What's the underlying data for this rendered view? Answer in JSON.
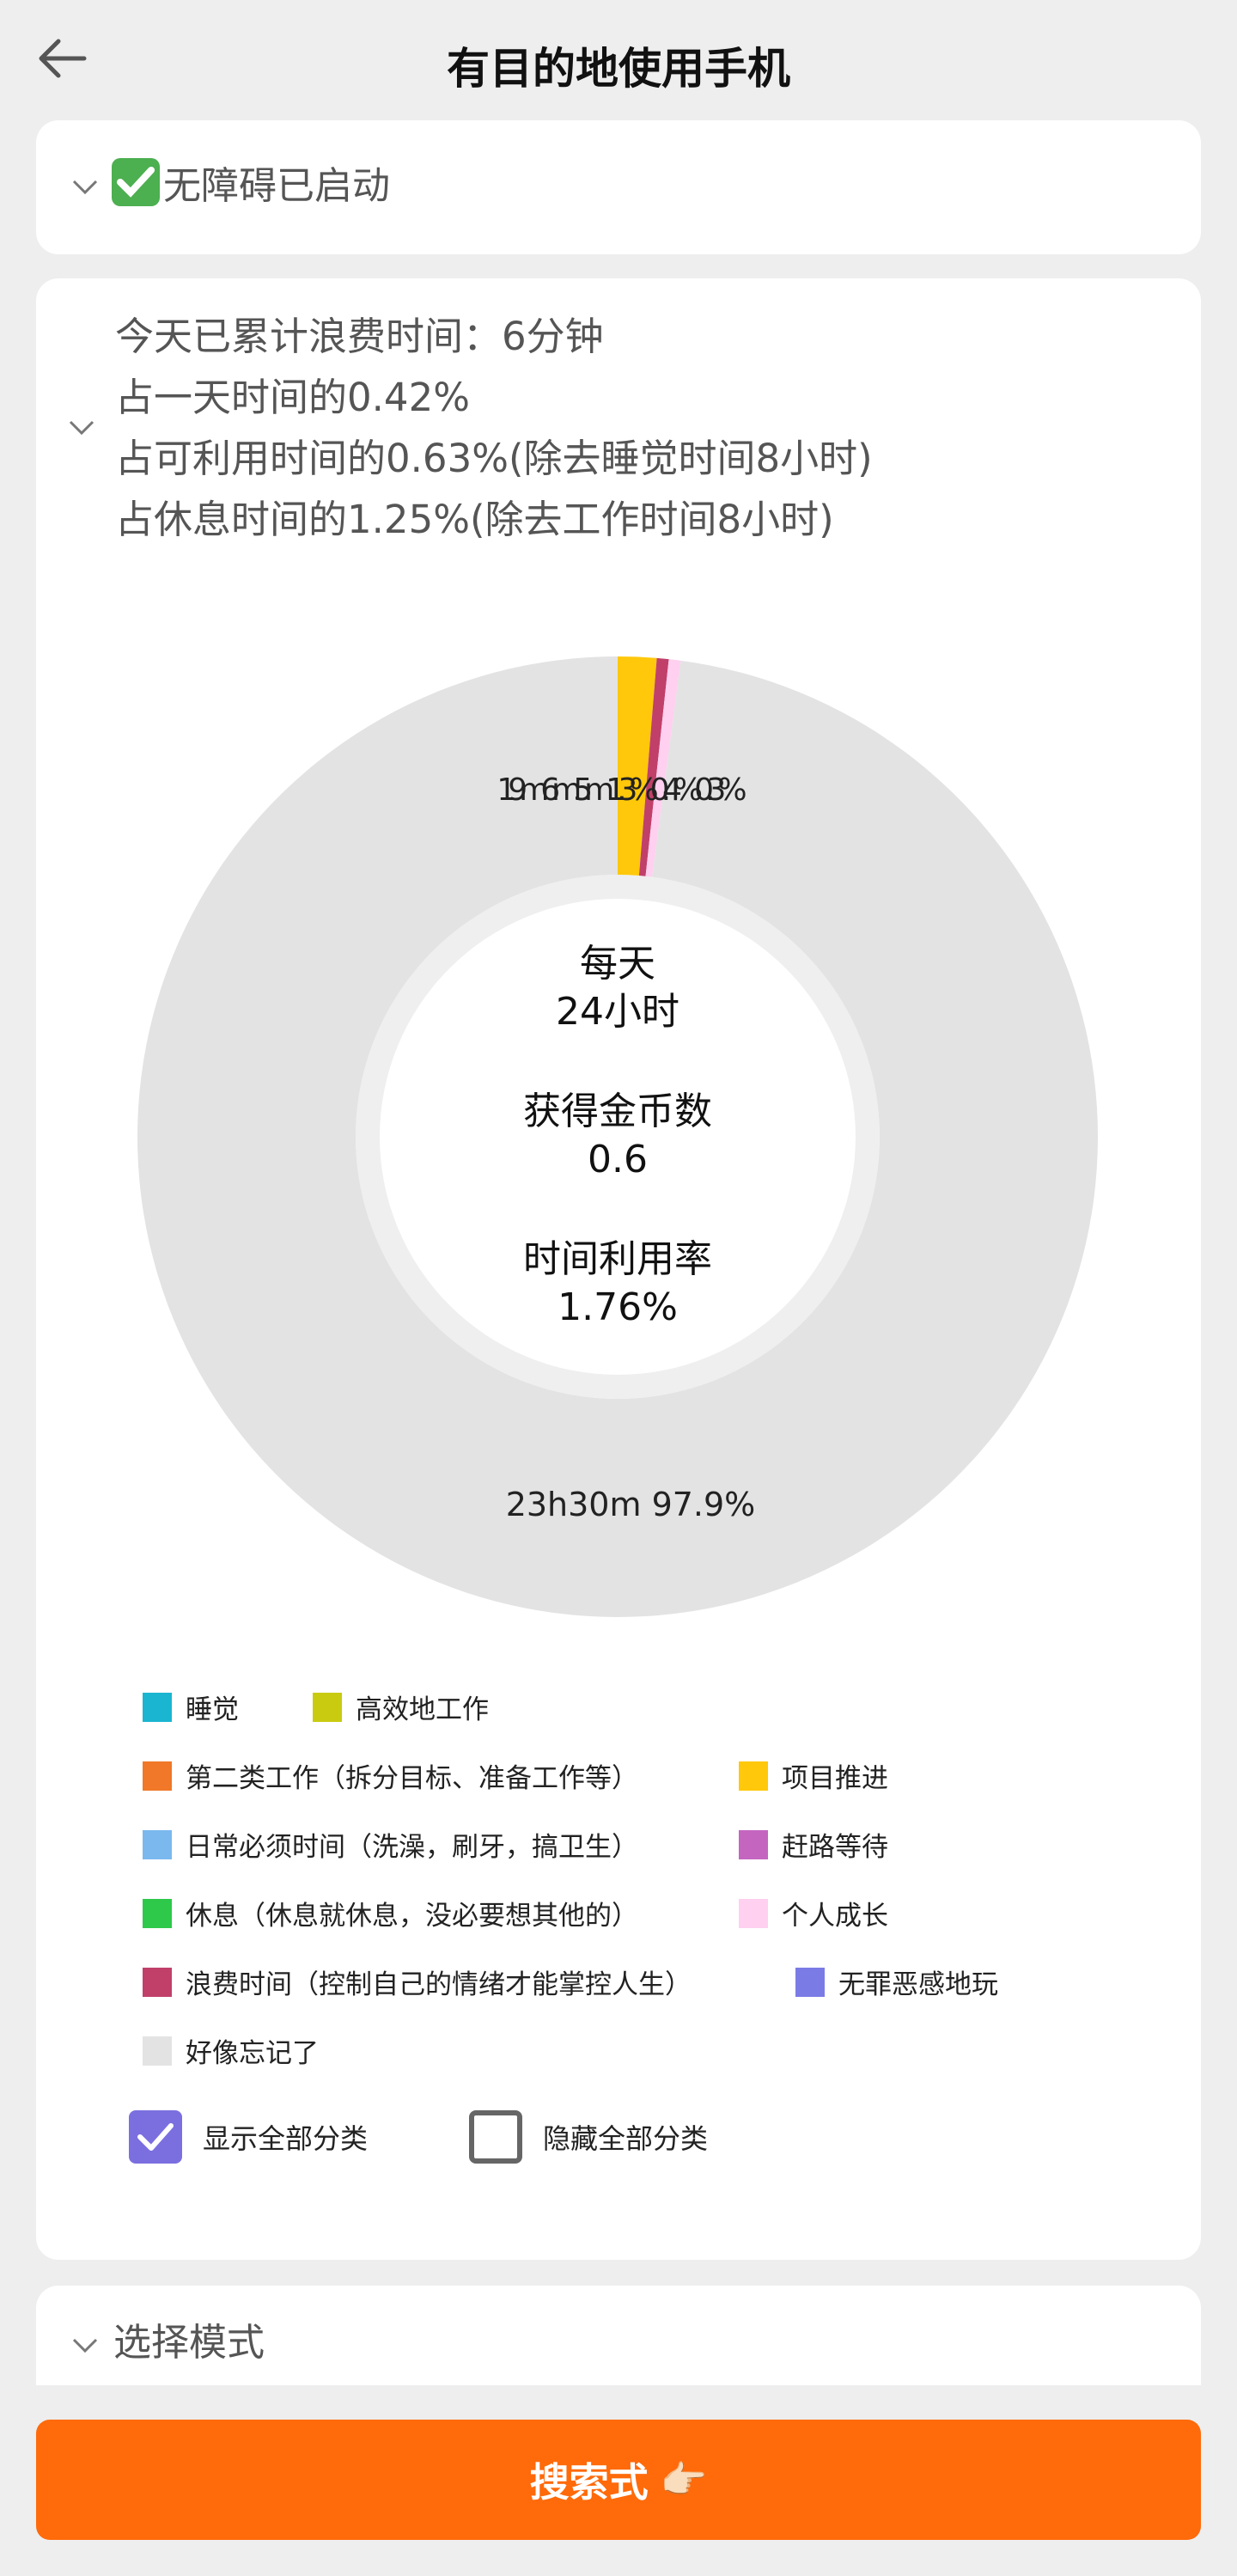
{
  "header": {
    "title": "有目的地使用手机"
  },
  "accessibility": {
    "label": "无障碍已启动"
  },
  "stats": {
    "line1": "今天已累计浪费时间：6分钟",
    "line2": "占一天时间的0.42%",
    "line3": "占可利用时间的0.63%(除去睡觉时间8小时)",
    "line4": "占休息时间的1.25%(除去工作时间8小时)"
  },
  "center": {
    "line1": "每天",
    "line2": "24小时",
    "line3": "获得金币数",
    "line4": "0.6",
    "line5": "时间利用率",
    "line6": "1.76%"
  },
  "chart_data": {
    "type": "pie",
    "slices": [
      {
        "name": "项目推进",
        "value": 1.3,
        "label": "19m 1.3%",
        "color": "#ffc80a"
      },
      {
        "name": "浪费时间（控制自己的情绪才能掌控人生）",
        "value": 0.4,
        "label": "6m 0.4%",
        "color": "#c0406a"
      },
      {
        "name": "个人成长",
        "value": 0.4,
        "label": "5m 0.3%",
        "color": "#ffd0f0"
      },
      {
        "name": "好像忘记了",
        "value": 97.9,
        "label": "23h30m 97.9%",
        "color": "#e3e3e3"
      }
    ],
    "small_label_text": "19m6m5m1.3%0.4%0.3%"
  },
  "legend": {
    "items": [
      {
        "label": "睡觉",
        "color": "#1ab5d0"
      },
      {
        "label": "高效地工作",
        "color": "#c8cb10"
      },
      {
        "label": "第二类工作（拆分目标、准备工作等）",
        "color": "#f07828"
      },
      {
        "label": "项目推进",
        "color": "#ffc80a"
      },
      {
        "label": "日常必须时间（洗澡，刷牙，搞卫生）",
        "color": "#7ab8ee"
      },
      {
        "label": "赶路等待",
        "color": "#c466c0"
      },
      {
        "label": "休息（休息就休息，没必要想其他的）",
        "color": "#2ec84a"
      },
      {
        "label": "个人成长",
        "color": "#ffd0f0"
      },
      {
        "label": "浪费时间（控制自己的情绪才能掌控人生）",
        "color": "#c0406a"
      },
      {
        "label": "无罪恶感地玩",
        "color": "#7b7be6"
      },
      {
        "label": "好像忘记了",
        "color": "#e3e3e3"
      }
    ]
  },
  "toggles": {
    "show_all": "显示全部分类",
    "hide_all": "隐藏全部分类"
  },
  "mode": {
    "title": "选择模式"
  },
  "search": {
    "label": "搜索式",
    "emoji": "👉🏻"
  }
}
